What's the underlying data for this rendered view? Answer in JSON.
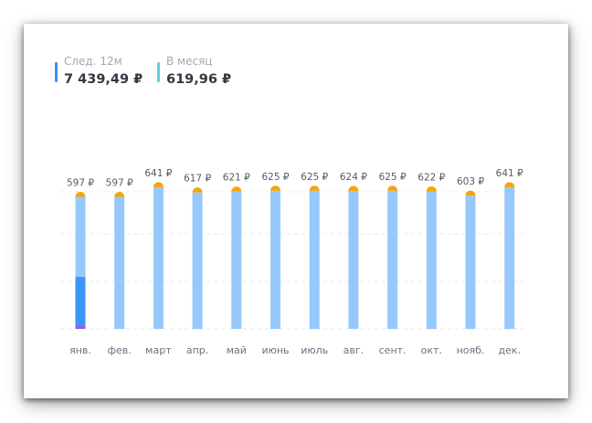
{
  "summary": {
    "next12": {
      "label": "След. 12м",
      "value": "7 439,49 ₽",
      "color": "#3b8ff3"
    },
    "monthly": {
      "label": "В месяц",
      "value": "619,96 ₽",
      "color": "#5dd1d6"
    }
  },
  "chart_data": {
    "type": "bar",
    "categories": [
      "янв.",
      "фев.",
      "март",
      "апр.",
      "май",
      "июнь",
      "июль",
      "авг.",
      "сент.",
      "окт.",
      "нояб.",
      "дек."
    ],
    "value_labels": [
      "597 ₽",
      "597 ₽",
      "641 ₽",
      "617 ₽",
      "621 ₽",
      "625 ₽",
      "625 ₽",
      "624 ₽",
      "625 ₽",
      "622 ₽",
      "603 ₽",
      "641 ₽"
    ],
    "values": [
      597,
      597,
      641,
      617,
      621,
      625,
      625,
      624,
      625,
      622,
      603,
      641
    ],
    "ylim": [
      0,
      700
    ],
    "grid": true,
    "legend": "none",
    "highlight_segments": [
      {
        "category": "янв.",
        "lower_value": 14,
        "upper_value": 235,
        "color": "#3b97f5"
      },
      {
        "category": "янв.",
        "lower_value": 0,
        "upper_value": 14,
        "color": "#9b5ce0"
      }
    ],
    "colors": {
      "bar": "#97c8fb",
      "cap": "#f5a50a",
      "grid": "#e6e8ec"
    }
  }
}
